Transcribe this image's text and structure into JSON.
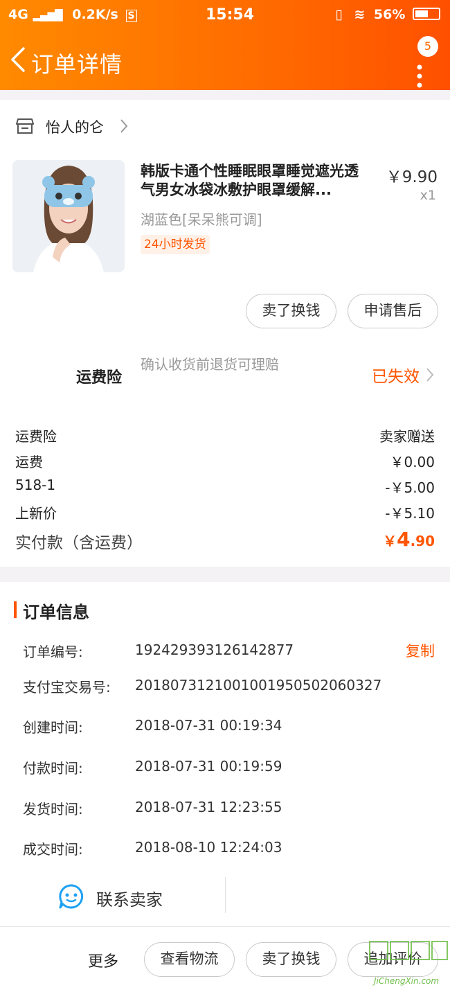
{
  "status_bar": {
    "network": "4G",
    "speed": "0.2K/s",
    "time": "15:54",
    "battery": "56%"
  },
  "nav": {
    "title": "订单详情",
    "badge_count": "5"
  },
  "shop": {
    "name": "怡人的仑"
  },
  "product": {
    "title": "韩版卡通个性睡眠眼罩睡觉遮光透气男女冰袋冰敷护眼罩缓解...",
    "price": "￥9.90",
    "quantity": "x1",
    "spec": "湖蓝色[呆呆熊可调]",
    "tag": "24小时发货"
  },
  "item_actions": {
    "sell_label": "卖了换钱",
    "after_sale_label": "申请售后"
  },
  "insurance": {
    "label": "运费险",
    "description": "确认收货前退货可理赔",
    "status": "已失效"
  },
  "fees": [
    {
      "label": "运费险",
      "value": "卖家赠送"
    },
    {
      "label": "运费",
      "value": "￥0.00"
    },
    {
      "label": "518-1",
      "value": "-￥5.00"
    },
    {
      "label": "上新价",
      "value": "-￥5.10"
    }
  ],
  "total": {
    "label": "实付款（含运费）",
    "currency": "￥",
    "integer": "4",
    "decimal": ".90"
  },
  "order_info": {
    "title": "订单信息",
    "copy_label": "复制",
    "rows": [
      {
        "label": "订单编号:",
        "value": "192429393126142877"
      },
      {
        "label": "支付宝交易号:",
        "value": "2018073121001001950502060327"
      },
      {
        "label": "创建时间:",
        "value": "2018-07-31 00:19:34"
      },
      {
        "label": "付款时间:",
        "value": "2018-07-31 00:19:59"
      },
      {
        "label": "发货时间:",
        "value": "2018-07-31 12:23:55"
      },
      {
        "label": "成交时间:",
        "value": "2018-08-10 12:24:03"
      }
    ]
  },
  "contact": {
    "label": "联系卖家"
  },
  "bottom_bar": {
    "more_label": "更多",
    "logistics_label": "查看物流",
    "sell_label": "卖了换钱",
    "review_label": "追加评价"
  },
  "watermark": {
    "text": "JiChengXin.com"
  },
  "colors": {
    "accent": "#ff5500",
    "header_start": "#ff8a00",
    "header_end": "#ff5000"
  }
}
